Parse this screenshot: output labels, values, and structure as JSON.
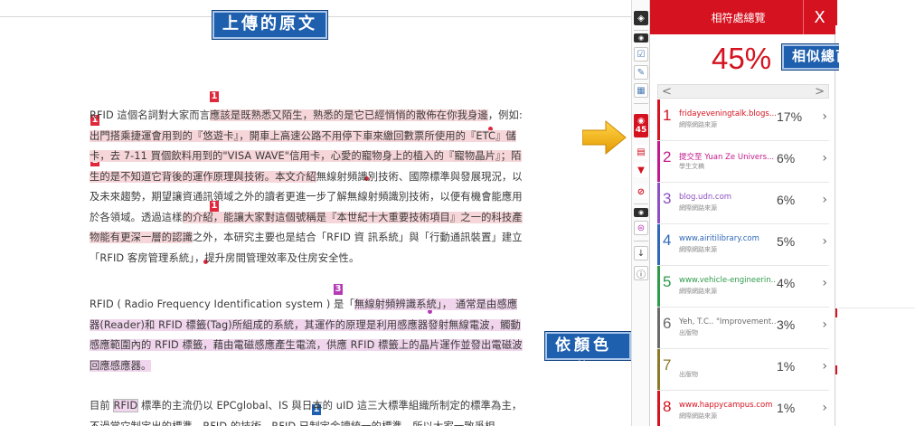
{
  "captions": {
    "uploaded_original": "上傳的原文",
    "total_similarity": "相似總百分比",
    "color_legend": "依顏色區分不同相似來源"
  },
  "document": {
    "p1": {
      "a": "RFID 這個名詞對大家而言",
      "b": "應該是既熟悉又陌生，熟悉的是它已經悄悄的散佈在你我身邊",
      "c": "，例如:",
      "d": "出門搭乘捷運會用到的『悠遊卡』，開車上高速公路不用停下車來繳回數票所使用的『ETC』儲",
      "e": "卡，去 7-11 買個飲料用到的\"VISA WAVE\"信用卡，心愛的寵物身上的植入的『寵物晶片』；",
      "f": "陌生的是不知道它背後的運作原理與技術。本文介紹",
      "g": "無線射頻識別技術、國際標準與發展現況，以及未來趨勢，期望讓",
      "h": "資通訊領域之外的讀者更進一步了解無線射頻識別技術，以便有機會能應用於各領域。透過這樣",
      "i": "的介紹，能讓大家對這個號稱是『本世紀十大重要技術項目』之一的科技",
      "j": "產物能有更深一層的認識",
      "k": "之外，本研究主要也是結合「RFID 資 訊系統」與「行動通訊裝置」建立「RFID 客房管理系統」，提升房間管理效率及住房安全性。"
    },
    "p2": {
      "a": "RFID ( Radio Frequency Identification system ) 是「",
      "b": "無線射頻辨識系統」",
      "c": "， 通常是由感應器(Reader)和 RFID 標籤(Tag)所組成的系統，其運作的原理是利用感應器發射無線電波，觸動感應範圍內的 RFID 標籤，藉由電磁感應產生電流，供應 RFID 標籤上的晶片運作並發出電磁波回應感應器。"
    },
    "p3": {
      "a": "目前 ",
      "b": "RFID",
      "c": " 標準的主流仍以 EPCglobal、IS",
      "d": " 與日本的 uID 這三大標準組織所制定的標準為",
      "e": "主，不過當它制定出的標準，RFID 的技術，RFID 已制定金讀統一的標準，所以大家一致爭相"
    },
    "markers": {
      "m1": "1",
      "m3": "3",
      "m1b": "1",
      "m1c": "1",
      "m1d": "1",
      "m1e": "1"
    }
  },
  "toolbar": {
    "match_count": "45"
  },
  "panel": {
    "title": "相符處總覽",
    "close": "X",
    "overall_percent": "45%",
    "prev": "<",
    "next": ">",
    "sources": [
      {
        "rank": "1",
        "title": "fridayeveningtalk.blogs...",
        "type": "網際網路來源",
        "percent": "17%",
        "color": "#d5121f"
      },
      {
        "rank": "2",
        "title": "提交至 Yuan Ze Univers...",
        "type": "學生文稿",
        "percent": "6%",
        "color": "#c21a8c"
      },
      {
        "rank": "3",
        "title": "blog.udn.com",
        "type": "網際網路來源",
        "percent": "6%",
        "color": "#8e4fc4"
      },
      {
        "rank": "4",
        "title": "www.airitilibrary.com",
        "type": "網際網路來源",
        "percent": "5%",
        "color": "#2f67b8"
      },
      {
        "rank": "5",
        "title": "www.vehicle-engineerin...",
        "type": "網際網路來源",
        "percent": "4%",
        "color": "#2e9a4a"
      },
      {
        "rank": "6",
        "title": "Yeh, T.C.. \"Improvement...",
        "type": "出版物",
        "percent": "3%",
        "color": "#6a6a6a"
      },
      {
        "rank": "7",
        "title": "",
        "type": "出版物",
        "percent": "1%",
        "color": "#8a7a2a"
      },
      {
        "rank": "8",
        "title": "www.happycampus.com",
        "type": "網際網路來源",
        "percent": "1%",
        "color": "#d5121f"
      }
    ]
  },
  "colors": {
    "accent_red": "#d5121f",
    "caption_blue": "#1e5fae",
    "highlight_red": "#f7d6d9",
    "highlight_purple": "#f0d5ec"
  }
}
